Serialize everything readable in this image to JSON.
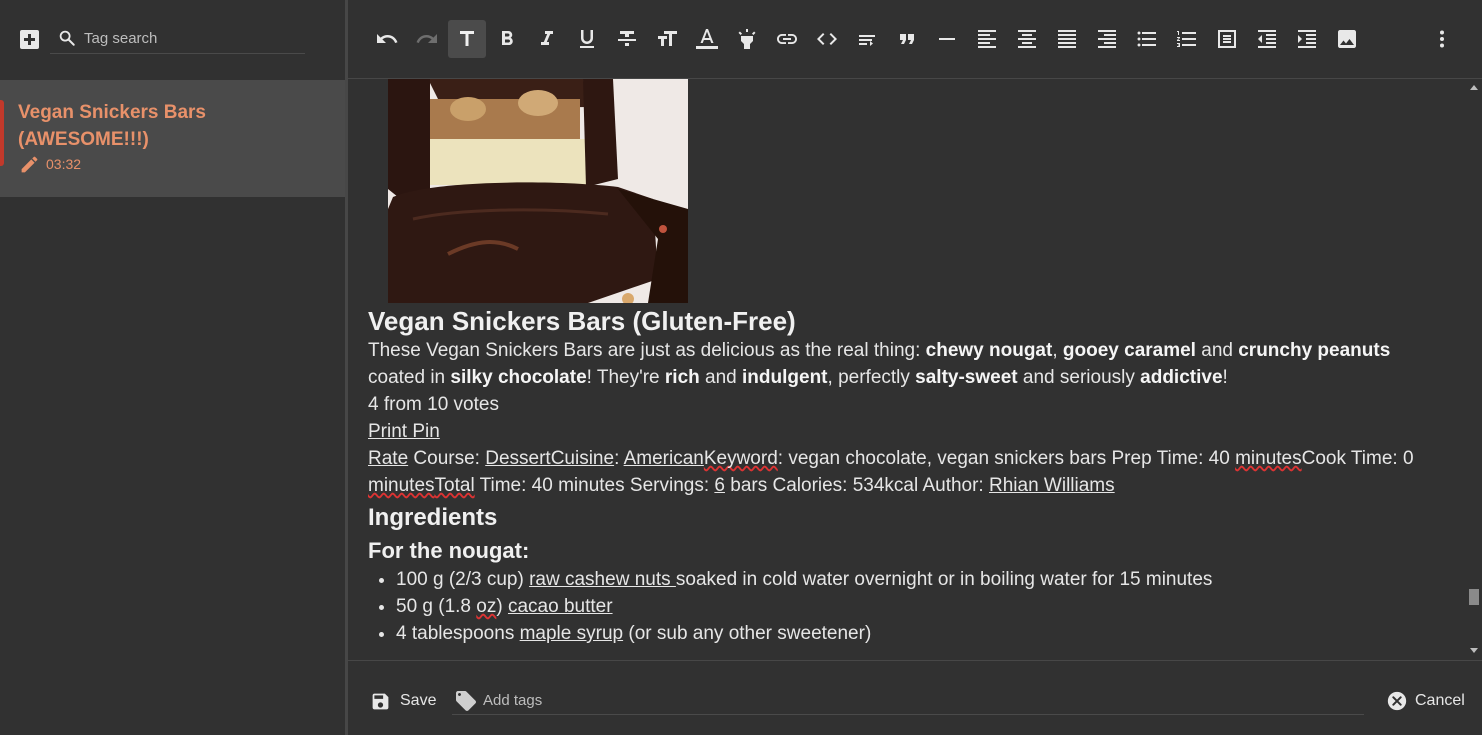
{
  "sidebar": {
    "search": {
      "placeholder": "Tag search",
      "value": ""
    },
    "add_icon": "add-box-icon",
    "notes": [
      {
        "title": "Vegan Snickers Bars (AWESOME!!!)",
        "time": "03:32",
        "icon": "pencil-icon",
        "selected": true
      }
    ]
  },
  "toolbar": {
    "buttons": [
      "undo-icon",
      "redo-icon",
      "text-format-icon",
      "bold-icon",
      "italic-icon",
      "underline-icon",
      "strikethrough-icon",
      "text-size-icon",
      "text-color-icon",
      "highlight-icon",
      "link-icon",
      "code-icon",
      "wrap-text-icon",
      "blockquote-icon",
      "horizontal-rule-icon",
      "align-left-icon",
      "align-center-icon",
      "align-justify-icon",
      "align-right-icon",
      "bulleted-list-icon",
      "numbered-list-icon",
      "checklist-icon",
      "outdent-icon",
      "indent-icon",
      "image-icon",
      "more-vertical-icon"
    ],
    "active": "text-format-icon"
  },
  "editor": {
    "image_alt": "Vegan Snickers bar cross-section",
    "heading": "Vegan Snickers Bars (Gluten-Free)",
    "intro": {
      "t1": "These Vegan Snickers Bars are just as delicious as the real thing: ",
      "b1": "chewy nougat",
      "t2": ", ",
      "b2": "gooey caramel",
      "t3": " and ",
      "b3": "crunchy peanuts",
      "t4": " coated in ",
      "b4": "silky chocolate",
      "t5": "! They're ",
      "b5": "rich",
      "t6": " and ",
      "b6": "indulgent",
      "t7": ", perfectly ",
      "b7": "salty-sweet",
      "t8": " and seriously ",
      "b8": "addictive",
      "t9": "!"
    },
    "rating": "4 from 10 votes",
    "print_pin": "Print Pin",
    "meta": {
      "rate": "Rate",
      "course_label": " Course: ",
      "course_value": "Dessert",
      "cuisine_label": "Cuisine",
      "cuisine_sep": ": ",
      "cuisine_value": "American",
      "keyword_label": "Keyword",
      "keyword_value": ": vegan chocolate, vegan snickers bars Prep Time: 40 ",
      "prep_minutes": "minutes",
      "cook_label": "Cook Time: 0 ",
      "cook_minutes": "minutes",
      "total_label": "Total",
      "total_value": " Time: 40 minutes Servings: ",
      "servings": "6",
      "rest": " bars Calories: 534kcal Author: ",
      "author": "Rhian Williams"
    },
    "ingredients_heading": "Ingredients",
    "nougat_heading": "For the nougat:",
    "ingredients": [
      {
        "pre": "100 g (2/3 cup) ",
        "link": "raw cashew nuts ",
        "post": "soaked in cold water overnight or in boiling water for 15 minutes"
      },
      {
        "pre": "50 g (1.8 ",
        "sp": "oz",
        "mid": ") ",
        "link": "cacao butter",
        "post": ""
      },
      {
        "pre": "4 tablespoons ",
        "link": "maple syrup",
        "post": " (or sub any other sweetener)"
      }
    ]
  },
  "footer": {
    "save_label": "Save",
    "tags_placeholder": "Add tags",
    "cancel_label": "Cancel"
  },
  "colors": {
    "background": "#313131",
    "selected_note": "#4a4a4a",
    "accent": "#e8916a",
    "active_bar": "#c1392b",
    "text": "#e6e6e6"
  }
}
